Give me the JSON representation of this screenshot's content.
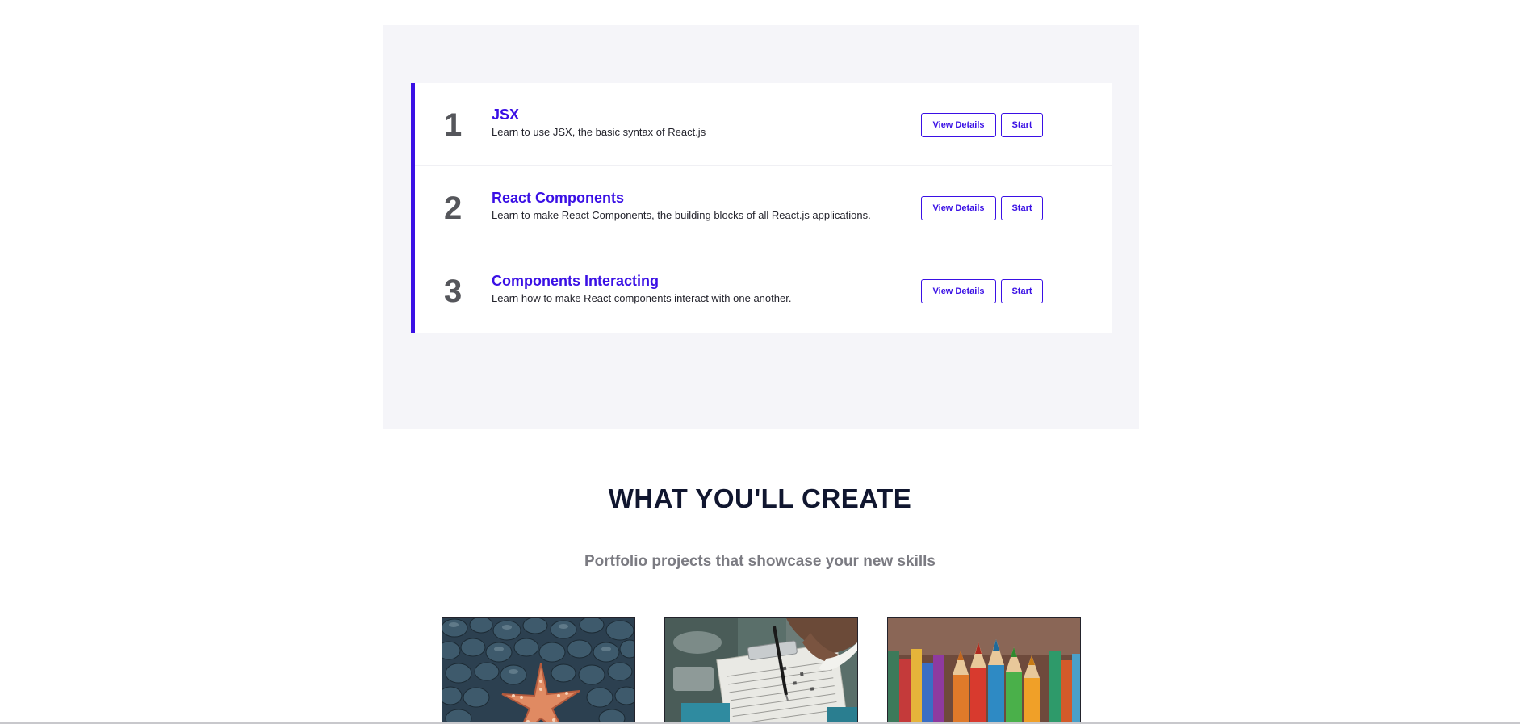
{
  "syllabus": {
    "lessons": [
      {
        "number": "1",
        "title": "JSX",
        "description": "Learn to use JSX, the basic syntax of React.js",
        "details_label": "View Details",
        "start_label": "Start"
      },
      {
        "number": "2",
        "title": "React Components",
        "description": "Learn to make React Components, the building blocks of all React.js applications.",
        "details_label": "View Details",
        "start_label": "Start"
      },
      {
        "number": "3",
        "title": "Components Interacting",
        "description": "Learn how to make React components interact with one another.",
        "details_label": "View Details",
        "start_label": "Start"
      }
    ]
  },
  "create_section": {
    "heading": "WHAT YOU'LL CREATE",
    "subheading": "Portfolio projects that showcase your new skills",
    "projects": [
      {
        "image": "starfish-on-pebbles"
      },
      {
        "image": "hand-writing-on-clipboard"
      },
      {
        "image": "colored-pencils"
      }
    ]
  },
  "colors": {
    "accent": "#3a10e5",
    "panel_background": "#f5f5f9",
    "heading": "#10162f",
    "subheading": "#7b7b82"
  }
}
